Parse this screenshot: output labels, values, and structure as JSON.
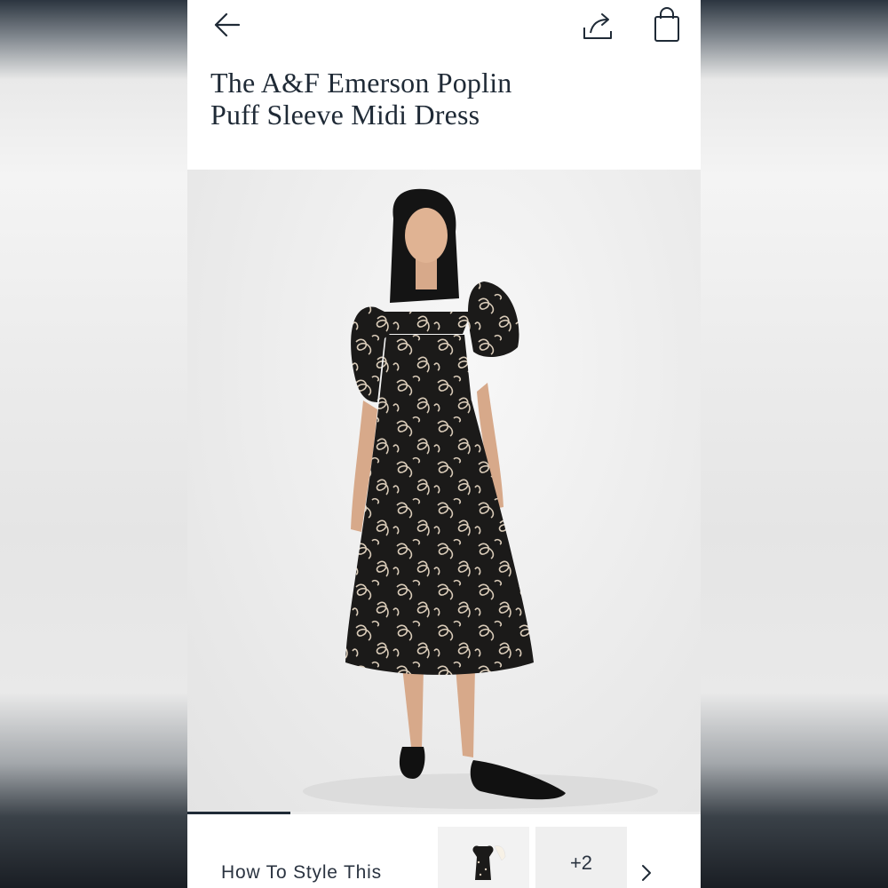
{
  "header": {
    "back_icon": "arrow-left-icon",
    "share_icon": "share-icon",
    "bag_icon": "shopping-bag-icon"
  },
  "product": {
    "title_line1": "The A&F Emerson Poplin",
    "title_line2": "Puff Sleeve Midi Dress"
  },
  "gallery": {
    "progress": 0.2
  },
  "style_section": {
    "label": "How To Style This",
    "more_count": "+2",
    "next_icon": "chevron-right-icon"
  },
  "colors": {
    "text": "#1f2a36",
    "dress": "#1b1a19",
    "pattern": "#d9cbb8"
  }
}
